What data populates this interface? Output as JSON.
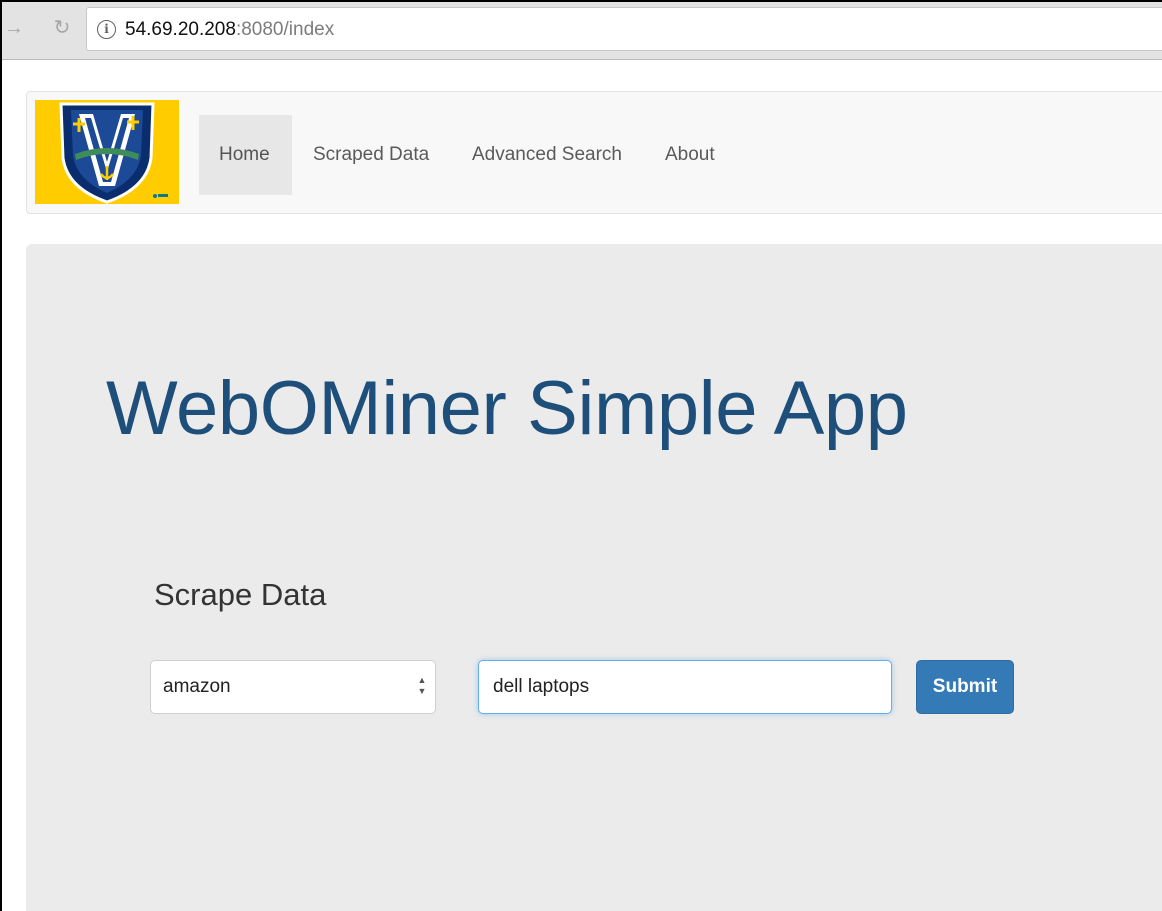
{
  "browser": {
    "url_host": "54.69.20.208",
    "url_rest": ":8080/index",
    "info_icon_glyph": "i",
    "forward_icon": "arrow-right-icon",
    "reload_icon": "reload-icon"
  },
  "navbar": {
    "logo_icon": "university-shield-logo",
    "logo_bg_color": "#ffcc00",
    "items": [
      {
        "label": "Home",
        "active": true
      },
      {
        "label": "Scraped Data",
        "active": false
      },
      {
        "label": "Advanced Search",
        "active": false
      },
      {
        "label": "About",
        "active": false
      }
    ]
  },
  "main": {
    "title": "WebOMiner Simple App",
    "title_color": "#1e4f7a",
    "form": {
      "heading": "Scrape Data",
      "site_select_value": "amazon",
      "query_value": "dell laptops",
      "submit_label": "Submit",
      "submit_color": "#337ab7"
    }
  }
}
